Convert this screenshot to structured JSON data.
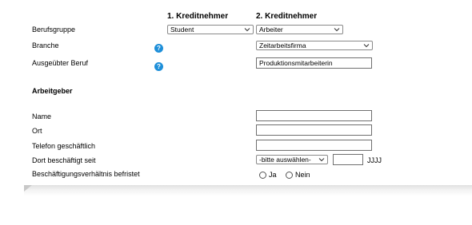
{
  "columns": {
    "borrower1": "1. Kreditnehmer",
    "borrower2": "2. Kreditnehmer"
  },
  "rows": {
    "occupation_group": {
      "label": "Berufsgruppe",
      "borrower1_value": "Student",
      "borrower2_value": "Arbeiter"
    },
    "industry": {
      "label": "Branche",
      "help_icon": "question-mark",
      "borrower2_value": "Zeitarbeitsfirma"
    },
    "profession": {
      "label": "Ausgeübter Beruf",
      "help_icon": "question-mark",
      "borrower2_value": "Produktionsmitarbeiterin"
    }
  },
  "employer": {
    "section_title": "Arbeitgeber",
    "name_label": "Name",
    "name_value": "",
    "city_label": "Ort",
    "city_value": "",
    "phone_label": "Telefon geschäftlich",
    "phone_value": "",
    "employed_since_label": "Dort beschäftigt seit",
    "month_select_value": "-bitte auswählen-",
    "year_value": "",
    "year_hint": "JJJJ",
    "fixed_term_label": "Beschäftigungsverhältnis befristet",
    "option_yes": "Ja",
    "option_no": "Nein"
  },
  "colors": {
    "help_icon": "#1e8fd9",
    "border": "#8a8a8a"
  }
}
